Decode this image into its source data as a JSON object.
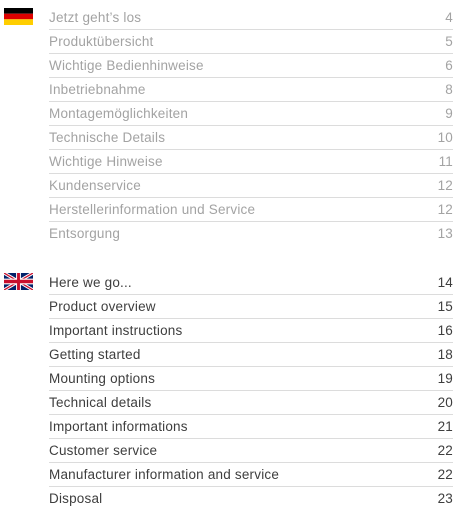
{
  "sections": [
    {
      "flag": "germany-flag",
      "items": [
        {
          "title": "Jetzt geht’s los",
          "page": "4"
        },
        {
          "title": "Produktübersicht",
          "page": "5"
        },
        {
          "title": "Wichtige Bedienhinweise",
          "page": "6"
        },
        {
          "title": "Inbetriebnahme",
          "page": "8"
        },
        {
          "title": "Montagemöglichkeiten",
          "page": "9"
        },
        {
          "title": "Technische Details",
          "page": "10"
        },
        {
          "title": "Wichtige Hinweise",
          "page": "11"
        },
        {
          "title": "Kundenservice",
          "page": "12"
        },
        {
          "title": "Herstellerinformation und Service",
          "page": "12"
        },
        {
          "title": "Entsorgung",
          "page": "13"
        }
      ]
    },
    {
      "flag": "uk-flag",
      "items": [
        {
          "title": "Here we go...",
          "page": "14"
        },
        {
          "title": "Product overview",
          "page": "15"
        },
        {
          "title": "Important instructions",
          "page": "16"
        },
        {
          "title": "Getting started",
          "page": "18"
        },
        {
          "title": "Mounting options",
          "page": "19"
        },
        {
          "title": "Technical details",
          "page": "20"
        },
        {
          "title": "Important informations",
          "page": "21"
        },
        {
          "title": "Customer service",
          "page": "22"
        },
        {
          "title": "Manufacturer information and service",
          "page": "22"
        },
        {
          "title": "Disposal",
          "page": "23"
        }
      ]
    }
  ]
}
